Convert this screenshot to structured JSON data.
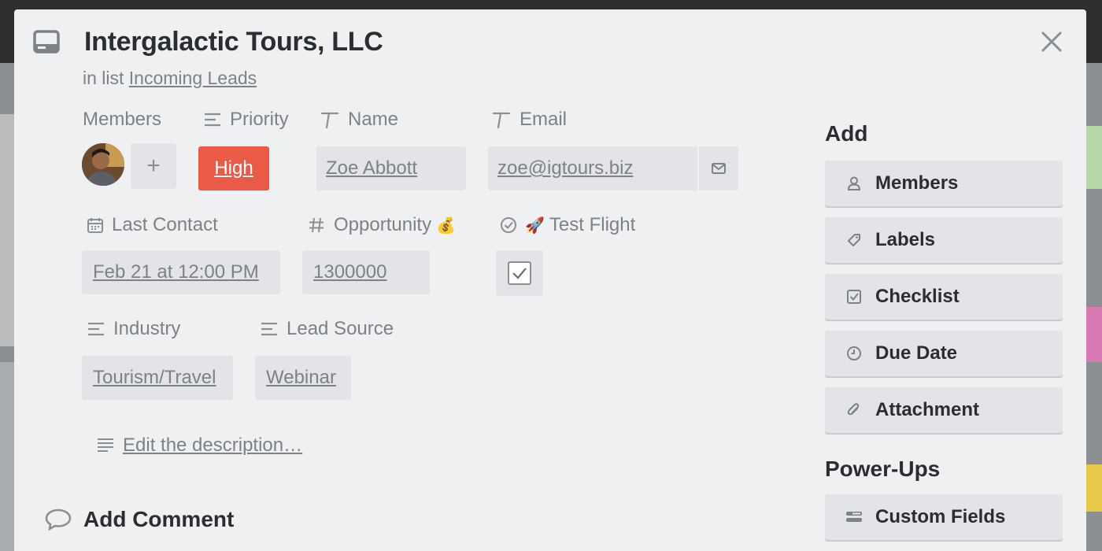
{
  "card": {
    "title": "Intergalactic Tours, LLC",
    "list_prefix": "in list",
    "list_name": "Incoming Leads"
  },
  "fields": {
    "members": {
      "label": "Members",
      "add_glyph": "+"
    },
    "priority": {
      "label": "Priority",
      "value": "High",
      "color": "#eb5a46"
    },
    "name": {
      "label": "Name",
      "value": "Zoe Abbott"
    },
    "email": {
      "label": "Email",
      "value": "zoe@igtours.biz"
    },
    "last_contact": {
      "label": "Last Contact",
      "value": "Feb 21 at 12:00 PM"
    },
    "opportunity": {
      "label": "Opportunity",
      "emoji": "💰",
      "value": "1300000"
    },
    "test_flight": {
      "label": "Test Flight",
      "emoji": "🚀",
      "checked": true
    },
    "industry": {
      "label": "Industry",
      "value": "Tourism/Travel"
    },
    "lead_source": {
      "label": "Lead Source",
      "value": "Webinar"
    }
  },
  "description": {
    "link_text": "Edit the description…"
  },
  "comment": {
    "heading": "Add Comment"
  },
  "sidebar": {
    "add_heading": "Add",
    "add_buttons": [
      {
        "label": "Members",
        "icon": "person-icon"
      },
      {
        "label": "Labels",
        "icon": "tag-icon"
      },
      {
        "label": "Checklist",
        "icon": "checkbox-icon"
      },
      {
        "label": "Due Date",
        "icon": "clock-icon"
      },
      {
        "label": "Attachment",
        "icon": "paperclip-icon"
      }
    ],
    "powerups_heading": "Power-Ups",
    "powerup_buttons": [
      {
        "label": "Custom Fields",
        "icon": "custom-fields-icon"
      }
    ]
  },
  "colors": {
    "modal_bg": "#eff0f2",
    "chip_bg": "#e3e4e7",
    "accent_red": "#eb5a46"
  }
}
